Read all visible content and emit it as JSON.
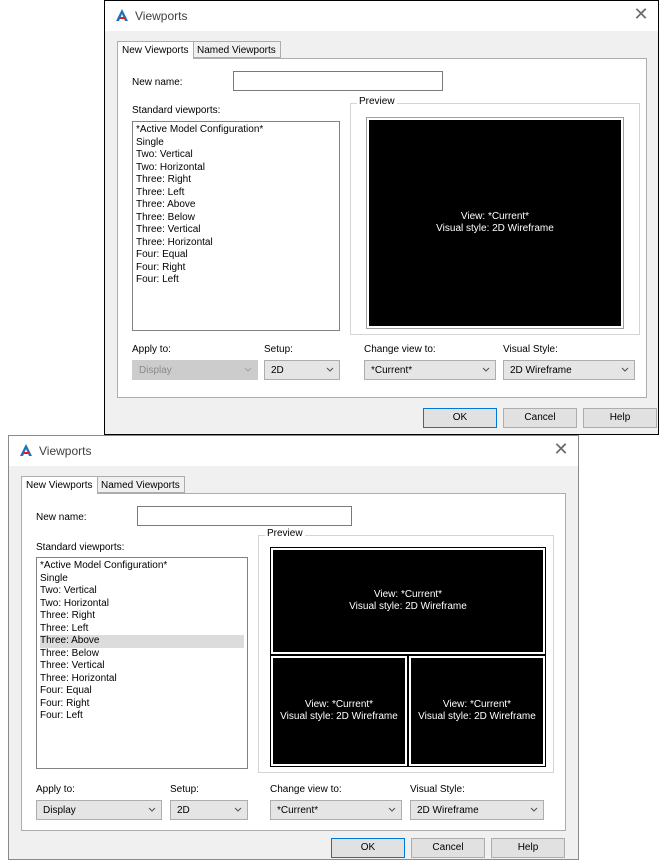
{
  "top": {
    "title": "Viewports",
    "tabs": [
      "New Viewports",
      "Named Viewports"
    ],
    "new_name_label": "New name:",
    "new_name_value": "",
    "standard_label": "Standard viewports:",
    "viewports": [
      "*Active Model Configuration*",
      "Single",
      "Two:  Vertical",
      "Two:  Horizontal",
      "Three: Right",
      "Three: Left",
      "Three: Above",
      "Three: Below",
      "Three: Vertical",
      "Three: Horizontal",
      "Four: Equal",
      "Four: Right",
      "Four: Left"
    ],
    "preview_label": "Preview",
    "preview_view": "View: *Current*",
    "preview_style": "Visual style: 2D Wireframe",
    "apply_label": "Apply to:",
    "apply_value": "Display",
    "setup_label": "Setup:",
    "setup_value": "2D",
    "change_label": "Change view to:",
    "change_value": "*Current*",
    "vstyle_label": "Visual Style:",
    "vstyle_value": "2D Wireframe",
    "ok": "OK",
    "cancel": "Cancel",
    "help": "Help"
  },
  "bottom": {
    "title": "Viewports",
    "tabs": [
      "New Viewports",
      "Named Viewports"
    ],
    "new_name_label": "New name:",
    "new_name_value": "",
    "standard_label": "Standard viewports:",
    "viewports": [
      "*Active Model Configuration*",
      "Single",
      "Two:  Vertical",
      "Two:  Horizontal",
      "Three: Right",
      "Three: Left",
      "Three: Above",
      "Three: Below",
      "Three: Vertical",
      "Three: Horizontal",
      "Four: Equal",
      "Four: Right",
      "Four: Left"
    ],
    "selected_index": 6,
    "preview_label": "Preview",
    "vp_top_view": "View: *Current*",
    "vp_top_style": "Visual style: 2D Wireframe",
    "vp_bl_view": "View: *Current*",
    "vp_bl_style": "Visual style: 2D Wireframe",
    "vp_br_view": "View: *Current*",
    "vp_br_style": "Visual style: 2D Wireframe",
    "apply_label": "Apply to:",
    "apply_value": "Display",
    "setup_label": "Setup:",
    "setup_value": "2D",
    "change_label": "Change view to:",
    "change_value": "*Current*",
    "vstyle_label": "Visual Style:",
    "vstyle_value": "2D Wireframe",
    "ok": "OK",
    "cancel": "Cancel",
    "help": "Help"
  },
  "colors": {
    "accent": "#0078d7",
    "preview_bg": "#000000",
    "dialog_bg": "#f0f0f0"
  },
  "icons": {
    "app": "autocad-icon",
    "close": "close-icon",
    "dropdown": "chevron-down-icon"
  }
}
